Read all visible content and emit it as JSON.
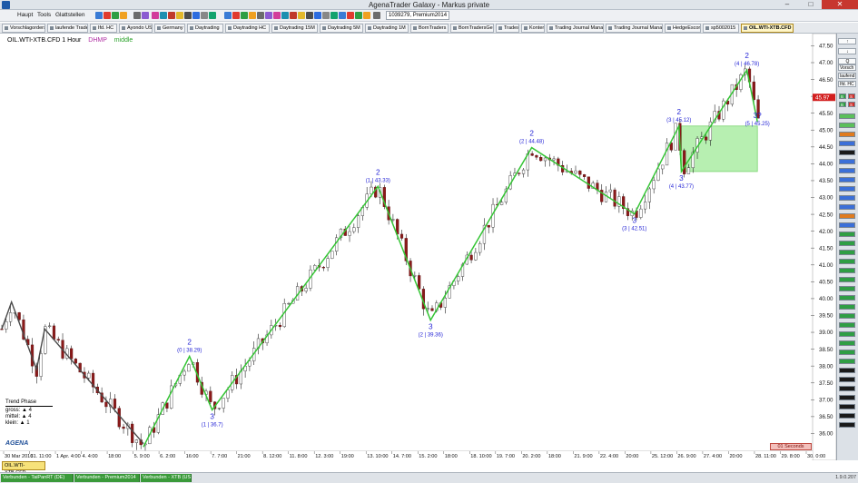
{
  "window": {
    "title": "AgenaTrader Galaxy - Markus private",
    "minimize": "–",
    "maximize": "□",
    "close": "✕"
  },
  "menu": [
    "Haupt",
    "Tools",
    "Glattstellen"
  ],
  "account_field": "1039279, Premium2014",
  "toolbar_icon_colors": [
    "#3a7bd5",
    "#e03a2f",
    "#2f9e44",
    "#f0a020",
    "#6b6b6b",
    "#8c5bd1",
    "#d23c9b",
    "#1d8fb0",
    "#c0392b",
    "#e3b82b",
    "#4d4d4d",
    "#2d6cdf",
    "#888888",
    "#13a36e"
  ],
  "tabs": [
    {
      "label": "Vorschlagorders",
      "w": 48
    },
    {
      "label": "laufende Trades",
      "w": 45
    },
    {
      "label": "Ifd. HC",
      "w": 30
    },
    {
      "label": "Ayondo US",
      "w": 37
    },
    {
      "label": "Germany",
      "w": 34
    },
    {
      "label": "Daytrading",
      "w": 40
    },
    {
      "label": "Daytrading HC",
      "w": 49
    },
    {
      "label": "Daytrading 15M",
      "w": 51
    },
    {
      "label": "Daytrading 5M",
      "w": 48
    },
    {
      "label": "Daytrading 1M",
      "w": 48
    },
    {
      "label": "BornTraders",
      "w": 42
    },
    {
      "label": "BornTradersGer",
      "w": 48
    },
    {
      "label": "Trades",
      "w": 26
    },
    {
      "label": "Konten",
      "w": 26
    },
    {
      "label": "Trading Journal Manager",
      "w": 63
    },
    {
      "label": "Trading Journal Manager",
      "w": 63
    },
    {
      "label": "HedgeEscort",
      "w": 40
    },
    {
      "label": "sp5002015",
      "w": 40
    },
    {
      "label": "OIL.WTI-XTB.CFD",
      "w": 58,
      "active": true
    }
  ],
  "chart": {
    "instrument": "OIL.WTI-XTB.CFD",
    "timeframe": "1 Hour",
    "indicator_1": "DHMP",
    "indicator_2": "middle",
    "current_price": "45.97",
    "countdown": "01 Seconds",
    "instrument_tab": "OIL.WTI-XTB.CFD",
    "colors": {
      "zigzag_green": "#35c535",
      "zigzag_gray": "#4a4a4a",
      "label_blue": "#2626d6",
      "zone_fill": "#b7efb1",
      "zone_stroke": "#7bd46f",
      "price_tag": "#d21d1d"
    }
  },
  "chart_data": {
    "type": "candlestick",
    "y_axis": {
      "min": 35.5,
      "max": 47.7,
      "ticks": [
        36.0,
        36.5,
        37.0,
        37.5,
        38.0,
        38.5,
        39.0,
        39.5,
        40.0,
        40.5,
        41.0,
        41.5,
        42.0,
        42.5,
        43.0,
        43.5,
        44.0,
        44.5,
        45.0,
        45.5,
        46.0,
        46.5,
        47.0,
        47.5
      ]
    },
    "x_ticks": [
      "30 Mar 2016",
      "31. 11:00",
      "1 Apr. 4:00",
      "4. 4:00",
      "18:00",
      "5. 9:00",
      "6. 2:00",
      "16:00",
      "7. 7:00",
      "21:00",
      "8. 12:00",
      "11. 8:00",
      "12. 3:00",
      "19:00",
      "13. 10:00",
      "14. 7:00",
      "15. 2:00",
      "18:00",
      "18. 10:00",
      "19. 7:00",
      "20. 2:00",
      "18:00",
      "21. 9:00",
      "22. 4:00",
      "20:00",
      "25. 12:00",
      "26. 9:00",
      "27. 4:00",
      "20:00",
      "28. 11:00",
      "29. 8:00",
      "30. 0:00"
    ],
    "zigzag_green_pivots": [
      {
        "t": 0.175,
        "v": 35.6
      },
      {
        "t": 0.232,
        "v": 38.29
      },
      {
        "t": 0.26,
        "v": 36.7
      },
      {
        "t": 0.465,
        "v": 43.33
      },
      {
        "t": 0.53,
        "v": 39.36
      },
      {
        "t": 0.655,
        "v": 44.48
      },
      {
        "t": 0.782,
        "v": 42.51
      },
      {
        "t": 0.837,
        "v": 45.12
      },
      {
        "t": 0.84,
        "v": 43.77
      },
      {
        "t": 0.921,
        "v": 46.78
      },
      {
        "t": 0.934,
        "v": 45.25
      }
    ],
    "zigzag_gray_pivots": [
      {
        "t": 0.0,
        "v": 39.1
      },
      {
        "t": 0.012,
        "v": 39.9
      },
      {
        "t": 0.043,
        "v": 37.9
      },
      {
        "t": 0.053,
        "v": 39.1
      },
      {
        "t": 0.175,
        "v": 35.7
      }
    ],
    "pivot_labels": [
      {
        "t": 0.232,
        "v": 38.29,
        "num": "2",
        "text": "(0 | 38.29)",
        "pos": "above"
      },
      {
        "t": 0.26,
        "v": 36.7,
        "num": "3",
        "text": "(1 | 36.7)",
        "pos": "below"
      },
      {
        "t": 0.465,
        "v": 43.33,
        "num": "2",
        "text": "(1 | 43.33)",
        "pos": "above"
      },
      {
        "t": 0.53,
        "v": 39.36,
        "num": "3",
        "text": "(2 | 39.36)",
        "pos": "below"
      },
      {
        "t": 0.655,
        "v": 44.48,
        "num": "2",
        "text": "(2 | 44.48)",
        "pos": "above"
      },
      {
        "t": 0.782,
        "v": 42.51,
        "num": "3",
        "text": "(3 | 42.51)",
        "pos": "below"
      },
      {
        "t": 0.837,
        "v": 45.12,
        "num": "2",
        "text": "(3 | 45.12)",
        "pos": "above"
      },
      {
        "t": 0.84,
        "v": 43.77,
        "num": "3",
        "text": "(4 | 43.77)",
        "pos": "below"
      },
      {
        "t": 0.921,
        "v": 46.78,
        "num": "2",
        "text": "(4 | 46.78)",
        "pos": "above"
      },
      {
        "t": 0.934,
        "v": 45.25,
        "num": "3?",
        "text": "(5 | 45.25)",
        "pos": "right"
      }
    ],
    "target_zone": {
      "t0": 0.84,
      "t1": 0.934,
      "v0": 43.77,
      "v1": 45.12
    },
    "seed": 7
  },
  "trend_phase": {
    "title": "Trend Phase",
    "rows": [
      "gross: ▲ 4",
      "mittel: ▲ 4",
      "klein: ▲ 1"
    ]
  },
  "logo": "AGENA",
  "side_panel": {
    "boxes": [
      "Vorsch",
      "laufend",
      "Ifd. HC"
    ],
    "buttons": [
      {
        "label": "B",
        "color": "#2f9e44"
      },
      {
        "label": "S",
        "color": "#d0312d"
      },
      {
        "label": "B",
        "color": "#2f9e44"
      },
      {
        "label": "S",
        "color": "#d0312d"
      }
    ],
    "ind_buttons": [
      "#5bbf5b",
      "#5bbf5b",
      "#e07b1f",
      "#3b6fd8",
      "#1a1a1a",
      "#3b6fd8",
      "#3b6fd8",
      "#3b6fd8",
      "#3b6fd8",
      "#3b6fd8",
      "#3b6fd8",
      "#e07b1f",
      "#3b6fd8",
      "#2f9e44",
      "#2f9e44",
      "#2f9e44",
      "#2f9e44",
      "#2f9e44",
      "#2f9e44",
      "#2f9e44",
      "#2f9e44",
      "#2f9e44",
      "#2f9e44",
      "#2f9e44",
      "#2f9e44",
      "#2f9e44",
      "#2f9e44",
      "#2f9e44",
      "#1a1a1a",
      "#1a1a1a",
      "#1a1a1a",
      "#1a1a1a",
      "#1a1a1a",
      "#1a1a1a",
      "#1a1a1a"
    ]
  },
  "status": [
    {
      "label": "Verbunden - TaiPanRT (DE)",
      "w": 80
    },
    {
      "label": "Verbunden - Premium2014",
      "w": 72
    },
    {
      "label": "Verbunden - XTB (US)",
      "w": 56
    }
  ],
  "version": "1.9.0.207"
}
